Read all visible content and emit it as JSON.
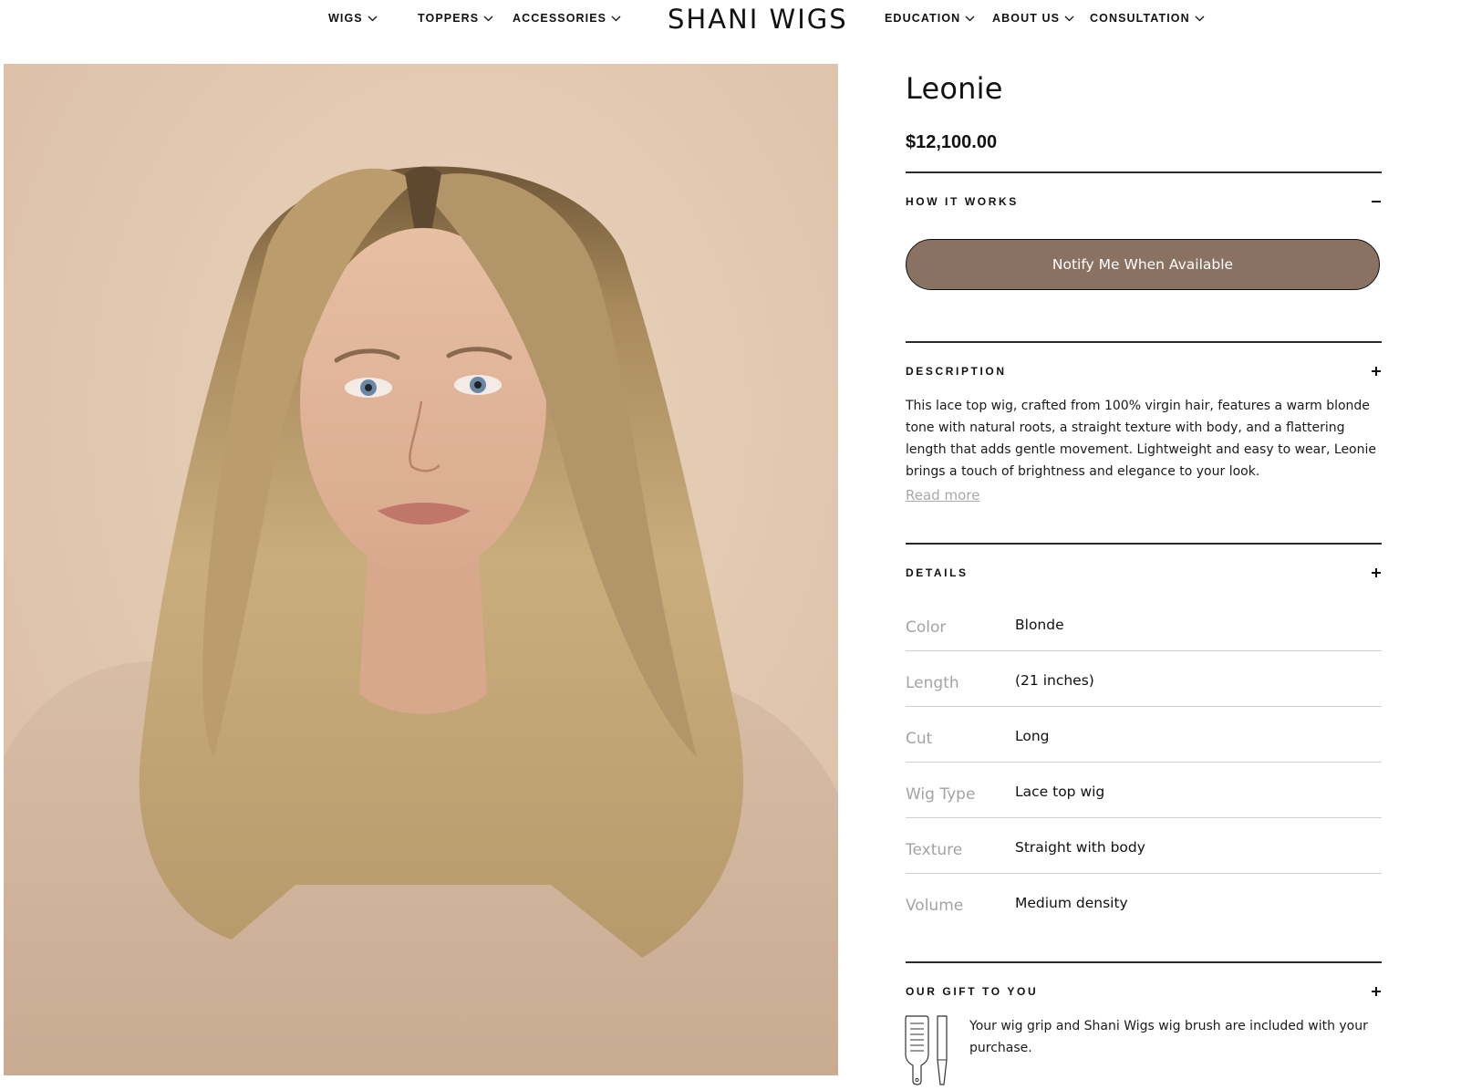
{
  "header": {
    "logo": "SHANI WIGS",
    "left_nav": [
      {
        "label": "WIGS"
      },
      {
        "label": "TOPPERS"
      },
      {
        "label": "ACCESSORIES"
      }
    ],
    "right_nav": [
      {
        "label": "EDUCATION"
      },
      {
        "label": "ABOUT US"
      },
      {
        "label": "CONSULTATION"
      }
    ]
  },
  "product": {
    "name": "Leonie",
    "price": "$12,100.00"
  },
  "how_it_works": {
    "title": "HOW IT WORKS",
    "state_icon": "minus-icon",
    "button_label": "Notify Me When Available"
  },
  "description": {
    "title": "DESCRIPTION",
    "state_icon": "plus-icon",
    "text": "This lace top wig, crafted from 100% virgin hair, features a warm blonde tone with natural roots, a straight texture with body, and a flattering length that adds gentle movement. Lightweight and easy to wear, Leonie brings a touch of brightness and elegance to your look.",
    "read_more": "Read more"
  },
  "details": {
    "title": "DETAILS",
    "state_icon": "plus-icon",
    "rows": [
      {
        "key": "Color",
        "value": "Blonde"
      },
      {
        "key": "Length",
        "value": "(21 inches)"
      },
      {
        "key": "Cut",
        "value": "Long"
      },
      {
        "key": "Wig Type",
        "value": "Lace top wig"
      },
      {
        "key": "Texture",
        "value": "Straight with body"
      },
      {
        "key": "Volume",
        "value": "Medium density"
      }
    ]
  },
  "gift": {
    "title": "OUR GIFT TO YOU",
    "state_icon": "plus-icon",
    "text": "Your wig grip and Shani Wigs wig brush are included with your purchase.",
    "icons": [
      "wig-brush-icon",
      "wig-comb-icon"
    ]
  },
  "colors": {
    "button_bg": "#8a7262",
    "photo_backdrop": "#e3c9b1",
    "muted_text": "#a3a3a3"
  }
}
